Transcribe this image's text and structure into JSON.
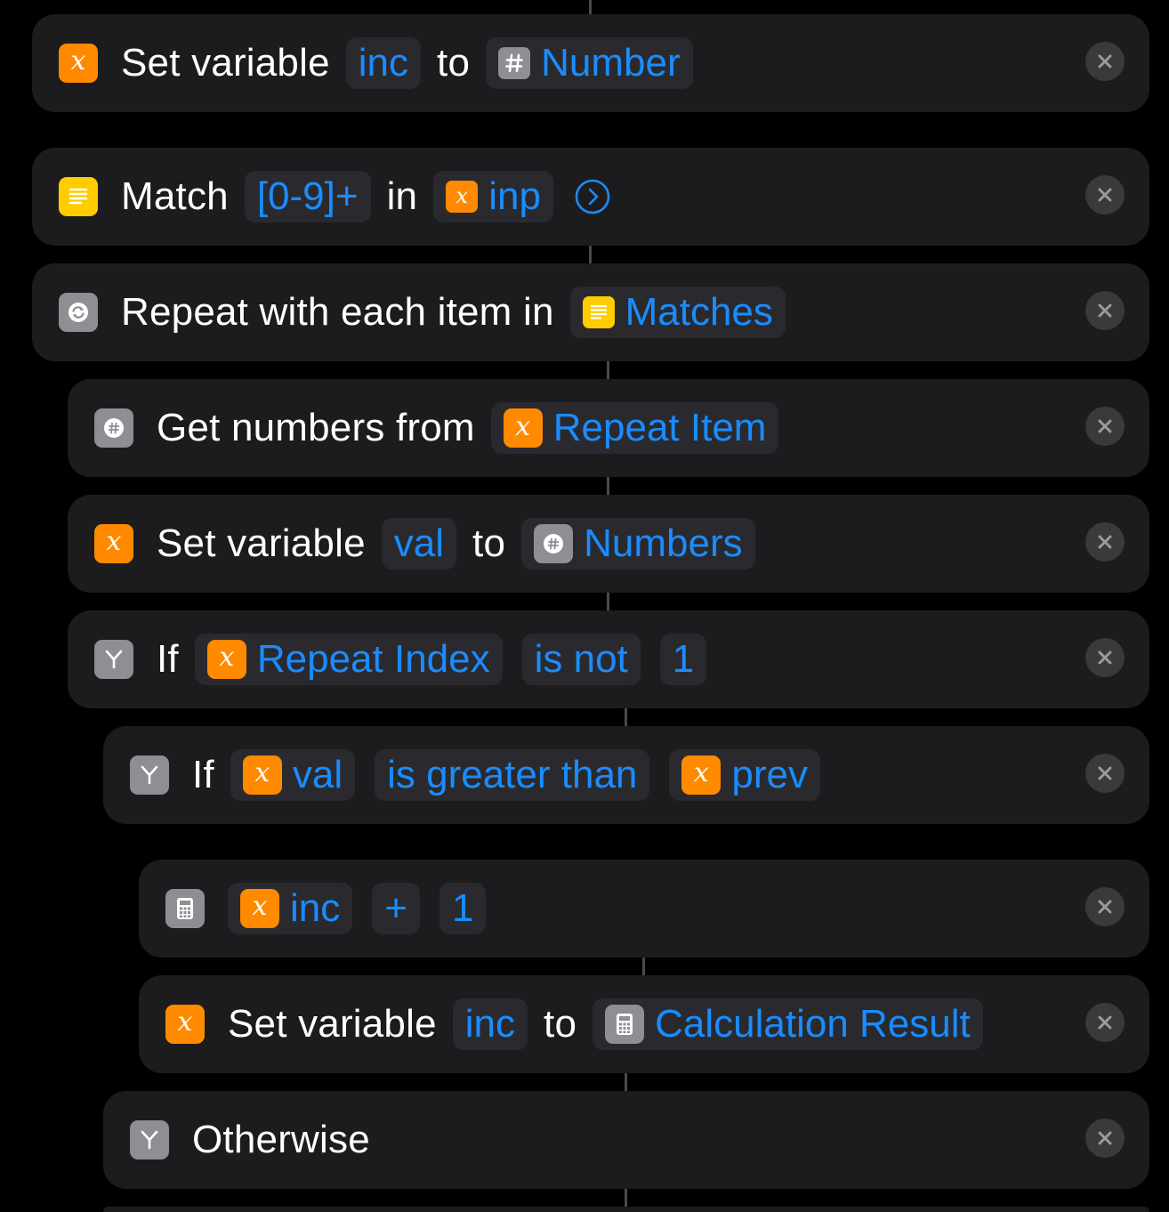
{
  "actions": [
    {
      "text": "Set variable",
      "variable": "inc",
      "to_label": "to",
      "value_label": "Number",
      "value_icon": "hash-icon"
    },
    {
      "text": "Match",
      "pattern": "[0-9]+",
      "in_label": "in",
      "source": "inp"
    },
    {
      "text": "Repeat with each item in",
      "source": "Matches"
    },
    {
      "text": "Get numbers from",
      "source": "Repeat Item"
    },
    {
      "text": "Set variable",
      "variable": "val",
      "to_label": "to",
      "value_label": "Numbers"
    },
    {
      "text": "If",
      "subject": "Repeat Index",
      "condition": "is not",
      "value": "1"
    },
    {
      "text": "If",
      "subject": "val",
      "condition": "is greater than",
      "value": "prev"
    },
    {
      "operand": "inc",
      "operator": "+",
      "value": "1"
    },
    {
      "text": "Set variable",
      "variable": "inc",
      "to_label": "to",
      "value_label": "Calculation Result"
    },
    {
      "text": "Otherwise"
    }
  ],
  "colors": {
    "background": "#000000",
    "card": "#1c1c1e",
    "pill": "#2a2a2e",
    "accent": "#1a8cff",
    "orange": "#ff8a00",
    "yellow": "#ffcc00",
    "gray": "#8e8e93"
  }
}
